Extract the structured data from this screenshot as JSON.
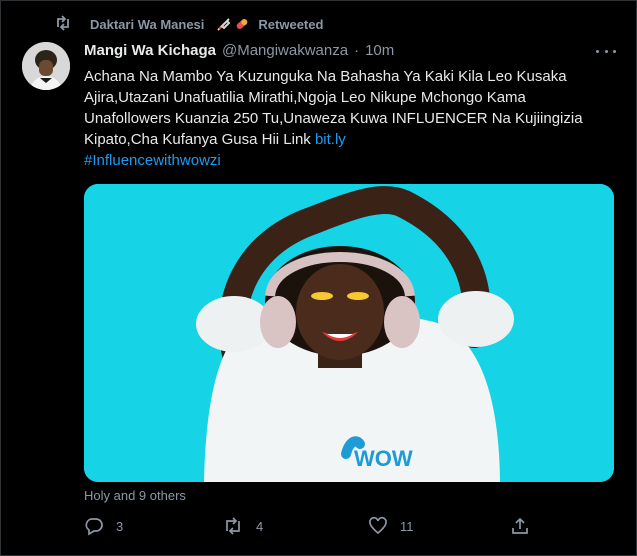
{
  "retweet": {
    "user": "Daktari Wa Manesi",
    "label": "Retweeted",
    "emojis": [
      "syringe-emoji",
      "pill-emoji"
    ]
  },
  "tweet": {
    "display_name": "Mangi Wa Kichaga",
    "handle": "@Mangiwakwanza",
    "separator": "·",
    "time": "10m",
    "text_lines": [
      "Achana Na Mambo Ya Kuzunguka Na Bahasha Ya Kaki Kila Leo Kusaka",
      "Ajira,Utazani Unafuatilia Mirathi,Ngoja Leo Nikupe Mchongo Kama",
      "Unafollowers Kuanzia 250 Tu,Unaweza Kuwa INFLUENCER Na Kujiingizia",
      "Kipato,Cha Kufanya Gusa Hii Link"
    ],
    "link": "bit.ly",
    "hashtag": "#Influencewithwowzi",
    "media_label": "WOW",
    "likers": "Holy and 9 others"
  },
  "actions": {
    "replies": "3",
    "retweets": "4",
    "likes": "11"
  },
  "colors": {
    "background": "#000000",
    "text": "#e7e9ea",
    "muted": "#8b98a5",
    "accent": "#1d9bf0",
    "media_bg": "#16d3e6"
  },
  "icons": [
    "retweet-icon",
    "more-icon",
    "reply-icon",
    "like-icon",
    "share-icon"
  ]
}
